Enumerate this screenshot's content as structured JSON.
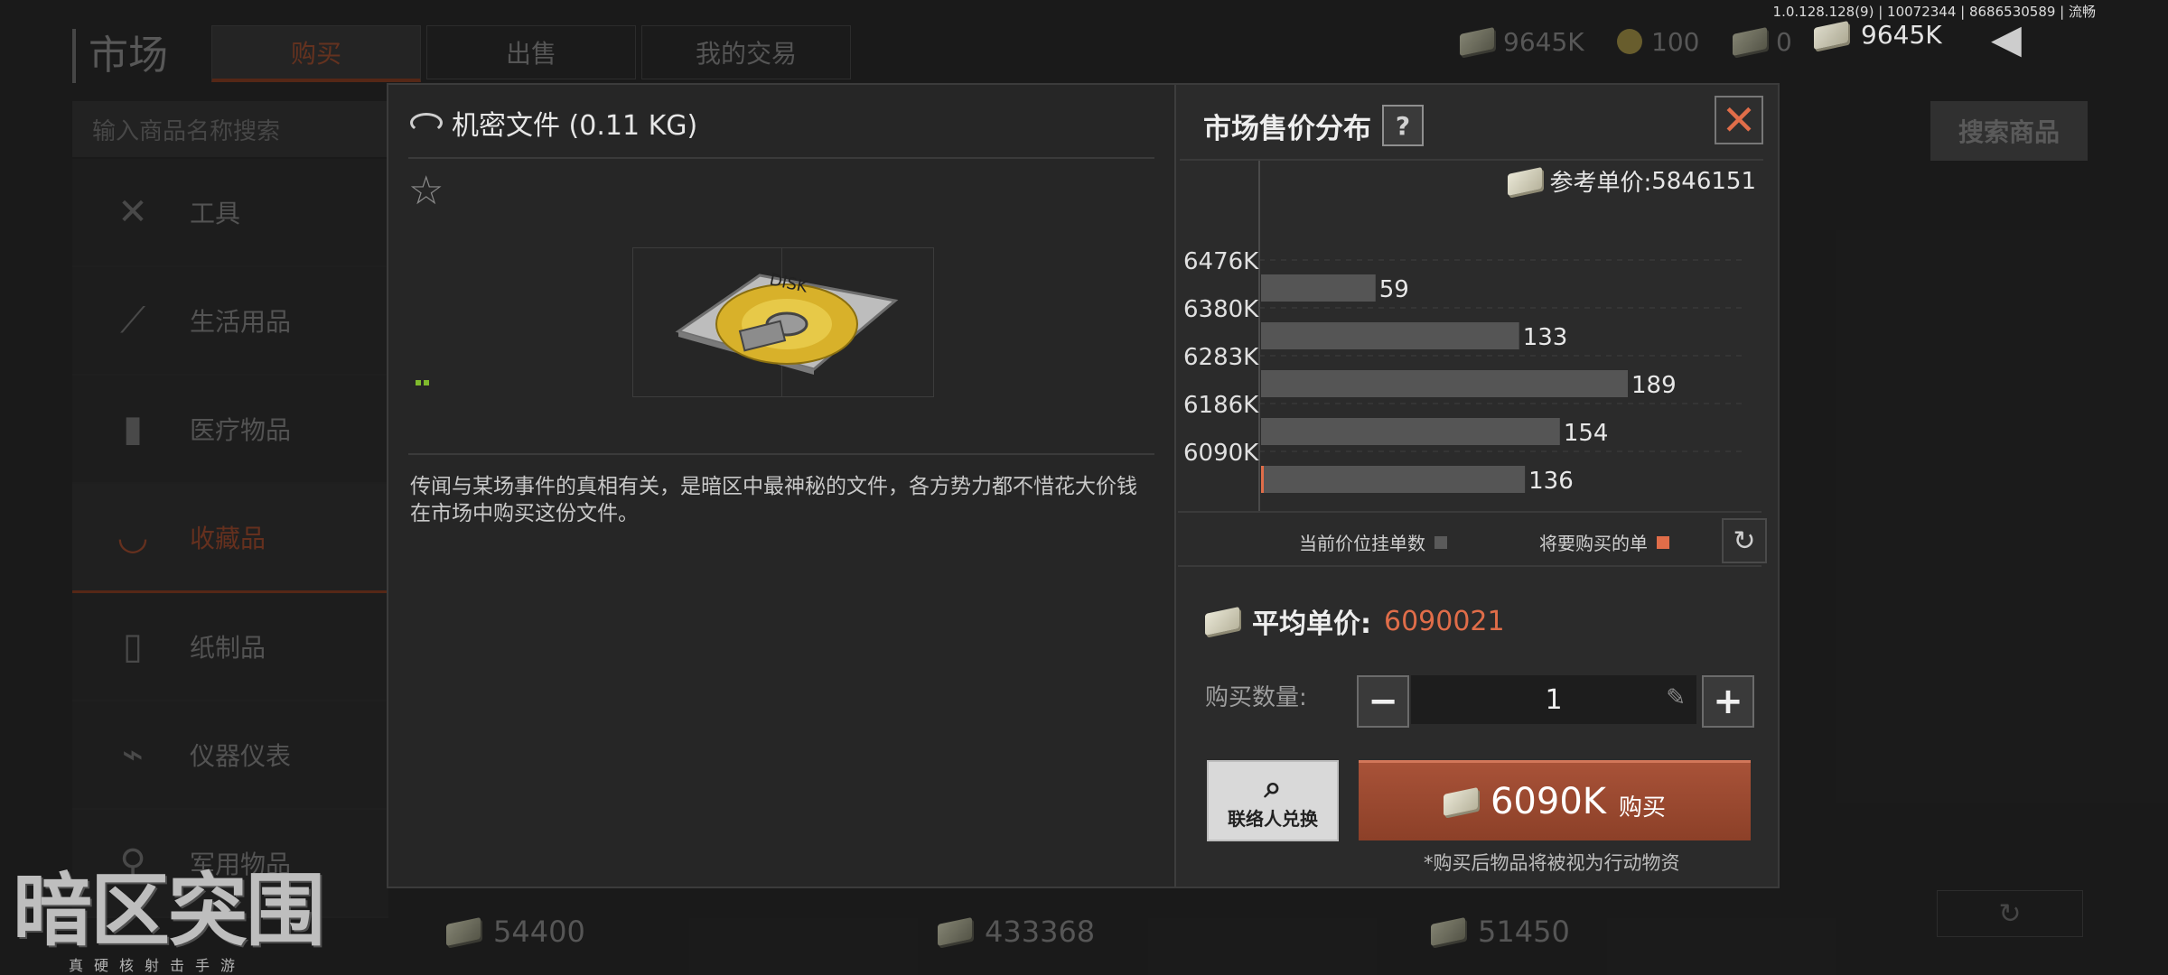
{
  "background": {
    "title": "市场",
    "tabs": [
      "购买",
      "出售",
      "我的交易"
    ],
    "active_tab": 0,
    "currencies": [
      {
        "icon": "cash-icon",
        "value": "9645K"
      },
      {
        "icon": "coin-icon",
        "value": "100"
      },
      {
        "icon": "cash-icon",
        "value": "0"
      }
    ],
    "search_placeholder": "输入商品名称搜索",
    "search_button": "搜索商品",
    "categories": [
      {
        "label": "工具",
        "icon": "tools-icon"
      },
      {
        "label": "生活用品",
        "icon": "daily-goods-icon"
      },
      {
        "label": "医疗物品",
        "icon": "medical-icon"
      },
      {
        "label": "收藏品",
        "icon": "collectible-icon",
        "active": true
      },
      {
        "label": "纸制品",
        "icon": "paper-icon"
      },
      {
        "label": "仪器仪表",
        "icon": "instrument-icon"
      },
      {
        "label": "军用物品",
        "icon": "military-icon"
      }
    ],
    "prices": [
      "54400",
      "433368",
      "51450"
    ],
    "refresh_icon": "refresh-icon"
  },
  "top_bar": {
    "version": "1.0.128.128(9) | 10072344 | 8686530589 | 流畅",
    "cash": "9645K",
    "back_icon": "back-arrow-icon"
  },
  "logo": {
    "main": "暗区突围",
    "sub": "真硬核射击手游"
  },
  "modal": {
    "item_name": "机密文件 (0.11 KG)",
    "reference_label": "参考单价:",
    "reference_price": "5846151",
    "description": "传闻与某场事件的真相有关，是暗区中最神秘的文件，各方势力都不惜花大价钱在市场中购买这份文件。",
    "distribution_title": "市场售价分布",
    "help": "?",
    "close": "✕",
    "legend_current": "当前价位挂单数",
    "legend_buy": "将要购买的单",
    "avg_label": "平均单价:",
    "avg_value": "6090021",
    "qty_label": "购买数量:",
    "qty_value": "1",
    "contact_label": "联络人兑换",
    "buy_price": "6090K",
    "buy_label": "购买",
    "note": "*购买后物品将被视为行动物资",
    "colors": {
      "accent": "#e06d49",
      "bar": "#555555",
      "buy_button": "#9a4a31"
    }
  },
  "chart_data": {
    "type": "bar",
    "orientation": "horizontal",
    "categories": [
      "6476K",
      "6380K",
      "6283K",
      "6186K",
      "6090K"
    ],
    "series": [
      {
        "values": [
          59,
          133,
          189,
          154,
          136
        ]
      }
    ],
    "xlim": [
      0,
      189
    ],
    "grid": true,
    "legend": "bottom-right"
  }
}
